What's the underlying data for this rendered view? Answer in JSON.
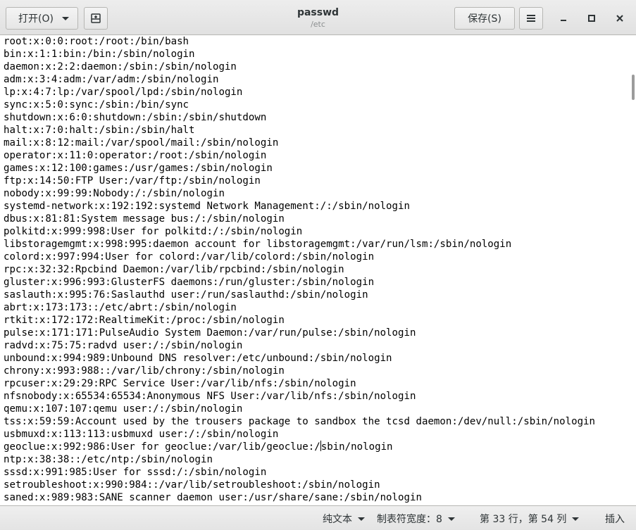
{
  "header": {
    "open_label": "打开(O)",
    "save_label": "保存(S)",
    "title": "passwd",
    "subtitle": "/etc",
    "icons": {
      "open_dropdown": "chevron-down-icon",
      "new_document": "new-document-icon",
      "menu": "hamburger-menu-icon",
      "minimize": "minimize-icon",
      "maximize": "maximize-icon",
      "close": "close-icon"
    }
  },
  "editor": {
    "lines": [
      "root:x:0:0:root:/root:/bin/bash",
      "bin:x:1:1:bin:/bin:/sbin/nologin",
      "daemon:x:2:2:daemon:/sbin:/sbin/nologin",
      "adm:x:3:4:adm:/var/adm:/sbin/nologin",
      "lp:x:4:7:lp:/var/spool/lpd:/sbin/nologin",
      "sync:x:5:0:sync:/sbin:/bin/sync",
      "shutdown:x:6:0:shutdown:/sbin:/sbin/shutdown",
      "halt:x:7:0:halt:/sbin:/sbin/halt",
      "mail:x:8:12:mail:/var/spool/mail:/sbin/nologin",
      "operator:x:11:0:operator:/root:/sbin/nologin",
      "games:x:12:100:games:/usr/games:/sbin/nologin",
      "ftp:x:14:50:FTP User:/var/ftp:/sbin/nologin",
      "nobody:x:99:99:Nobody:/:/sbin/nologin",
      "systemd-network:x:192:192:systemd Network Management:/:/sbin/nologin",
      "dbus:x:81:81:System message bus:/:/sbin/nologin",
      "polkitd:x:999:998:User for polkitd:/:/sbin/nologin",
      "libstoragemgmt:x:998:995:daemon account for libstoragemgmt:/var/run/lsm:/sbin/nologin",
      "colord:x:997:994:User for colord:/var/lib/colord:/sbin/nologin",
      "rpc:x:32:32:Rpcbind Daemon:/var/lib/rpcbind:/sbin/nologin",
      "gluster:x:996:993:GlusterFS daemons:/run/gluster:/sbin/nologin",
      "saslauth:x:995:76:Saslauthd user:/run/saslauthd:/sbin/nologin",
      "abrt:x:173:173::/etc/abrt:/sbin/nologin",
      "rtkit:x:172:172:RealtimeKit:/proc:/sbin/nologin",
      "pulse:x:171:171:PulseAudio System Daemon:/var/run/pulse:/sbin/nologin",
      "radvd:x:75:75:radvd user:/:/sbin/nologin",
      "unbound:x:994:989:Unbound DNS resolver:/etc/unbound:/sbin/nologin",
      "chrony:x:993:988::/var/lib/chrony:/sbin/nologin",
      "rpcuser:x:29:29:RPC Service User:/var/lib/nfs:/sbin/nologin",
      "nfsnobody:x:65534:65534:Anonymous NFS User:/var/lib/nfs:/sbin/nologin",
      "qemu:x:107:107:qemu user:/:/sbin/nologin",
      "tss:x:59:59:Account used by the trousers package to sandbox the tcsd daemon:/dev/null:/sbin/nologin",
      "usbmuxd:x:113:113:usbmuxd user:/:/sbin/nologin",
      "geoclue:x:992:986:User for geoclue:/var/lib/geoclue:/sbin/nologin",
      "ntp:x:38:38::/etc/ntp:/sbin/nologin",
      "sssd:x:991:985:User for sssd:/:/sbin/nologin",
      "setroubleshoot:x:990:984::/var/lib/setroubleshoot:/sbin/nologin",
      "saned:x:989:983:SANE scanner daemon user:/usr/share/sane:/sbin/nologin"
    ],
    "cursor": {
      "line": 33,
      "column": 54
    }
  },
  "statusbar": {
    "language": "纯文本",
    "tab_width": "制表符宽度：8",
    "position": "第 33 行，第 54 列",
    "insert_mode": "插入"
  }
}
